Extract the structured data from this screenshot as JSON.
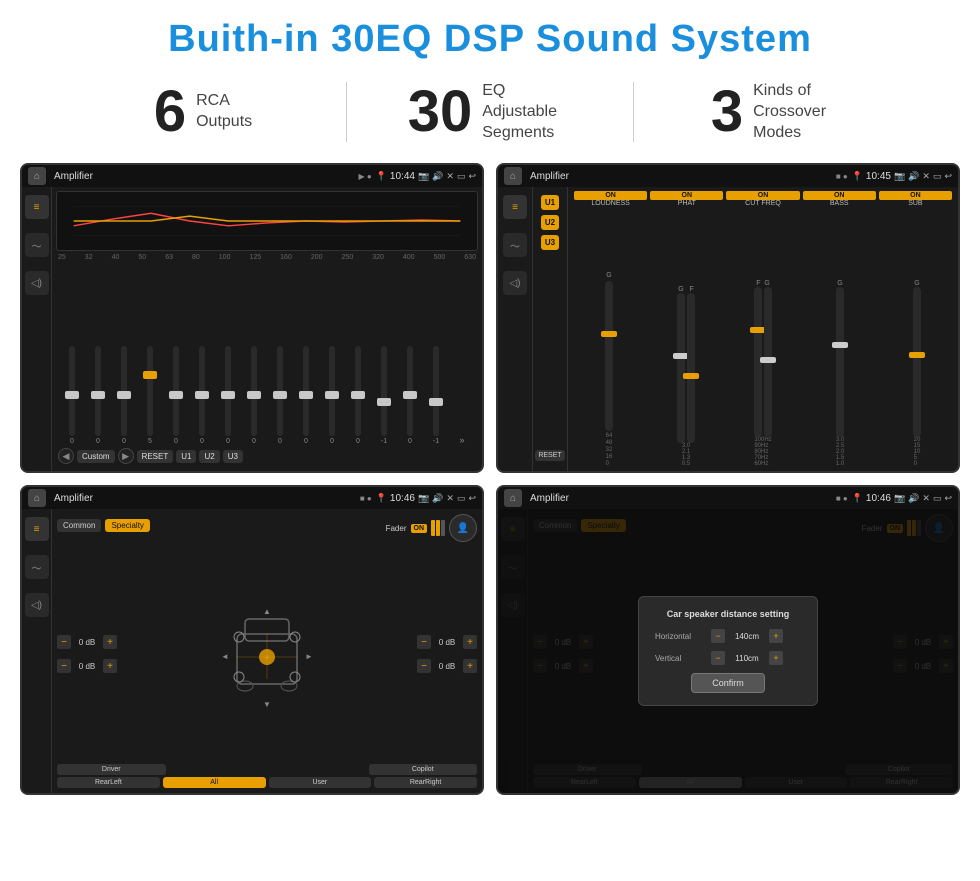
{
  "header": {
    "title": "Buith-in 30EQ DSP Sound System"
  },
  "stats": [
    {
      "number": "6",
      "label": "RCA\nOutputs"
    },
    {
      "number": "30",
      "label": "EQ Adjustable\nSegments"
    },
    {
      "number": "3",
      "label": "Kinds of\nCrossover Modes"
    }
  ],
  "screens": [
    {
      "id": "screen1",
      "status_bar": {
        "title": "Amplifier",
        "time": "10:44"
      }
    },
    {
      "id": "screen2",
      "status_bar": {
        "title": "Amplifier",
        "time": "10:45"
      }
    },
    {
      "id": "screen3",
      "status_bar": {
        "title": "Amplifier",
        "time": "10:46"
      }
    },
    {
      "id": "screen4",
      "status_bar": {
        "title": "Amplifier",
        "time": "10:46"
      },
      "dialog": {
        "title": "Car speaker distance setting",
        "horizontal_label": "Horizontal",
        "horizontal_value": "140cm",
        "vertical_label": "Vertical",
        "vertical_value": "110cm",
        "confirm_label": "Confirm"
      }
    }
  ],
  "eq_freqs": [
    "25",
    "32",
    "40",
    "50",
    "63",
    "80",
    "100",
    "125",
    "160",
    "200",
    "250",
    "320",
    "400",
    "500",
    "630"
  ],
  "eq_values": [
    "0",
    "0",
    "0",
    "5",
    "0",
    "0",
    "0",
    "0",
    "0",
    "0",
    "0",
    "0",
    "-1",
    "0",
    "-1"
  ],
  "eq_buttons": [
    "Custom",
    "RESET",
    "U1",
    "U2",
    "U3"
  ],
  "crossover_channels": [
    {
      "name": "LOUDNESS",
      "on": true
    },
    {
      "name": "PHAT",
      "on": true
    },
    {
      "name": "CUT FREQ",
      "on": true
    },
    {
      "name": "BASS",
      "on": true
    },
    {
      "name": "SUB",
      "on": true
    }
  ],
  "u_buttons": [
    "U1",
    "U2",
    "U3"
  ],
  "fader_tabs": [
    "Common",
    "Specialty"
  ],
  "db_controls": [
    {
      "value": "0 dB",
      "position": "top-left"
    },
    {
      "value": "0 dB",
      "position": "top-right"
    },
    {
      "value": "0 dB",
      "position": "bottom-left"
    },
    {
      "value": "0 dB",
      "position": "bottom-right"
    }
  ],
  "bottom_buttons": [
    "Driver",
    "",
    "Copilot",
    "RearLeft",
    "All",
    "User",
    "RearRight"
  ],
  "colors": {
    "accent": "#e8a000",
    "bg_dark": "#1a1a1a",
    "title_blue": "#1a8fde"
  }
}
